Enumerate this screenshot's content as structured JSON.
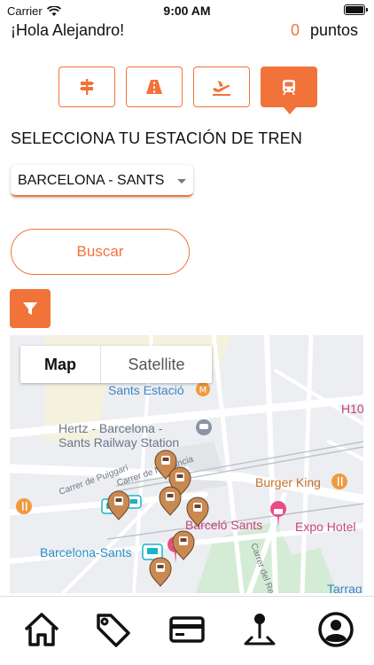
{
  "status_bar": {
    "carrier": "Carrier",
    "time": "9:00 AM"
  },
  "header": {
    "greeting": "¡Hola  Alejandro!",
    "points_value": "0",
    "points_label": "puntos"
  },
  "transport_modes": [
    {
      "icon": "signpost-icon",
      "active": false
    },
    {
      "icon": "highway-icon",
      "active": false
    },
    {
      "icon": "airplane-icon",
      "active": false
    },
    {
      "icon": "train-icon",
      "active": true
    }
  ],
  "station_section": {
    "title": "SELECCIONA TU ESTACIÓN DE TREN",
    "selected_station": "BARCELONA - SANTS"
  },
  "search_button": {
    "label": "Buscar"
  },
  "filter_button": {
    "icon": "filter-icon"
  },
  "map": {
    "type_toggle": {
      "map_label": "Map",
      "satellite_label": "Satellite",
      "selected": "Map"
    },
    "labels": {
      "sants_estacio": "Sants Estació",
      "hertz_line1": "Hertz - Barcelona -",
      "hertz_line2": "Sants Railway Station",
      "carrer_puiggari": "Carrer de Puiggarí",
      "carrer_numancia": "Carrer de Numància",
      "burger_king": "Burger King",
      "barcelo_sants": "Barceló Sants",
      "expo_hotel": "Expo Hotel",
      "barcelona_sants": "Barcelona-Sants",
      "carrer_del_rec": "Carrer del Rec",
      "h10": "H10",
      "tarrag": "Tarrag"
    }
  },
  "tab_bar": [
    {
      "icon": "home-icon"
    },
    {
      "icon": "tag-icon"
    },
    {
      "icon": "credit-card-icon"
    },
    {
      "icon": "map-pin-icon"
    },
    {
      "icon": "user-account-icon"
    }
  ],
  "colors": {
    "accent": "#f2733a",
    "pin": "#c98a52",
    "map_background": "#eceef1",
    "park": "#d4ecd6"
  }
}
